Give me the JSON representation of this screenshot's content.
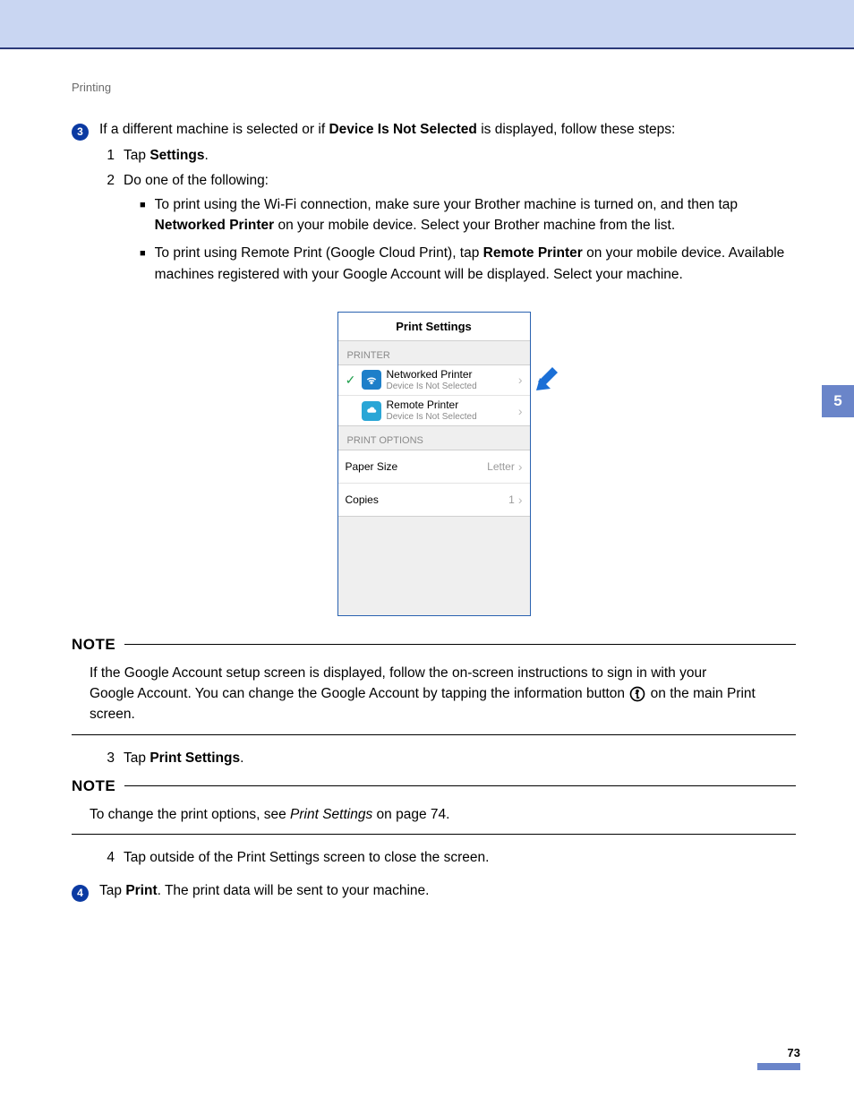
{
  "breadcrumb": "Printing",
  "side_tab": "5",
  "page_number": "73",
  "step3": {
    "bullet": "3",
    "text_before": "If a different machine is selected or if ",
    "text_bold": "Device Is Not Selected",
    "text_after": " is displayed, follow these steps:",
    "sub1_num": "1",
    "sub1_a": "Tap ",
    "sub1_b": "Settings",
    "sub1_c": ".",
    "sub2_num": "2",
    "sub2_text": "Do one of the following:",
    "b1_a": "To print using the Wi-Fi connection, make sure your Brother machine is turned on, and then tap ",
    "b1_b": "Networked Printer",
    "b1_c": " on your mobile device. Select your Brother machine from the list.",
    "b2_a": "To print using Remote Print (Google Cloud Print), tap ",
    "b2_b": "Remote Printer",
    "b2_c": " on your mobile device. Available machines registered with your Google Account will be displayed. Select your machine.",
    "sub3_num": "3",
    "sub3_a": "Tap ",
    "sub3_b": "Print Settings",
    "sub3_c": ".",
    "sub4_num": "4",
    "sub4_text": "Tap outside of the Print Settings screen to close the screen."
  },
  "phone": {
    "title": "Print Settings",
    "printer_label": "PRINTER",
    "row1_title": "Networked Printer",
    "row1_sub": "Device Is Not Selected",
    "row2_title": "Remote Printer",
    "row2_sub": "Device Is Not Selected",
    "options_label": "PRINT OPTIONS",
    "opt1_label": "Paper Size",
    "opt1_value": "Letter",
    "opt2_label": "Copies",
    "opt2_value": "1"
  },
  "note1": {
    "head": "NOTE",
    "line1": "If the Google Account setup screen is displayed, follow the on-screen instructions to sign in with your ",
    "line2a": "Google Account. You can change the Google Account by tapping the information button ",
    "line2b": " on the main Print screen."
  },
  "note2": {
    "head": "NOTE",
    "a": "To change the print options, see ",
    "b": "Print Settings",
    "c": " on page 74."
  },
  "step4": {
    "bullet": "4",
    "a": "Tap ",
    "b": "Print",
    "c": ". The print data will be sent to your machine."
  }
}
